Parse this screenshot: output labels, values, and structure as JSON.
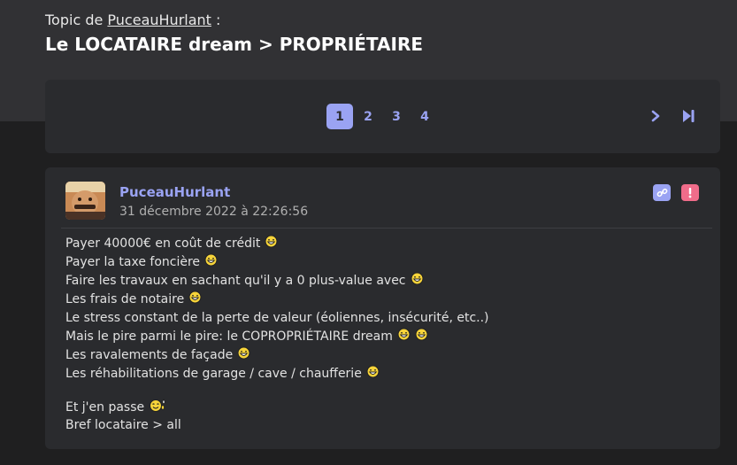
{
  "topic": {
    "prefix": "Topic de",
    "author": "PuceauHurlant",
    "suffix": ":",
    "title": "Le LOCATAIRE dream > PROPRIÉTAIRE"
  },
  "pagination": {
    "pages": [
      "1",
      "2",
      "3",
      "4"
    ],
    "active_page": "1",
    "next_icon": "chevron-right-icon",
    "last_icon": "skip-to-last-icon"
  },
  "post": {
    "author": "PuceauHurlant",
    "date": "31 décembre 2022 à 22:26:56",
    "avatar": "user-avatar",
    "actions": {
      "link_icon": "link-icon",
      "report_icon": "alert-icon"
    },
    "lines": [
      {
        "text": "Payer 40000€ en coût de crédit",
        "smileys": [
          "laugh-smiley-icon"
        ]
      },
      {
        "text": "Payer la taxe foncière",
        "smileys": [
          "laugh-smiley-icon"
        ]
      },
      {
        "text": "Faire les travaux en sachant qu'il y a 0 plus-value avec",
        "smileys": [
          "laugh-smiley-icon"
        ]
      },
      {
        "text": "Les frais de notaire",
        "smileys": [
          "laugh-smiley-icon"
        ]
      },
      {
        "text": "Le stress constant de la perte de valeur (éoliennes, insécurité, etc..)",
        "smileys": []
      },
      {
        "text": "Mais le pire parmi le pire: le COPROPRIÉTAIRE dream",
        "smileys": [
          "laugh-smiley-icon",
          "laugh-smiley-icon"
        ]
      },
      {
        "text": "Les ravalements de façade",
        "smileys": [
          "laugh-smiley-icon"
        ]
      },
      {
        "text": "Les réhabilitations de garage / cave / chaufferie",
        "smileys": [
          "laugh-smiley-icon"
        ]
      }
    ],
    "closing": [
      {
        "text": "Et j'en passe",
        "smileys": [
          "sweat-smiley-icon"
        ]
      },
      {
        "text": "Bref locataire > all",
        "smileys": []
      }
    ]
  },
  "colors": {
    "accent": "#9aa3f3",
    "report": "#f06c8a",
    "background": "#1f1f20",
    "panel": "#2a2b2e",
    "header": "#313134"
  }
}
